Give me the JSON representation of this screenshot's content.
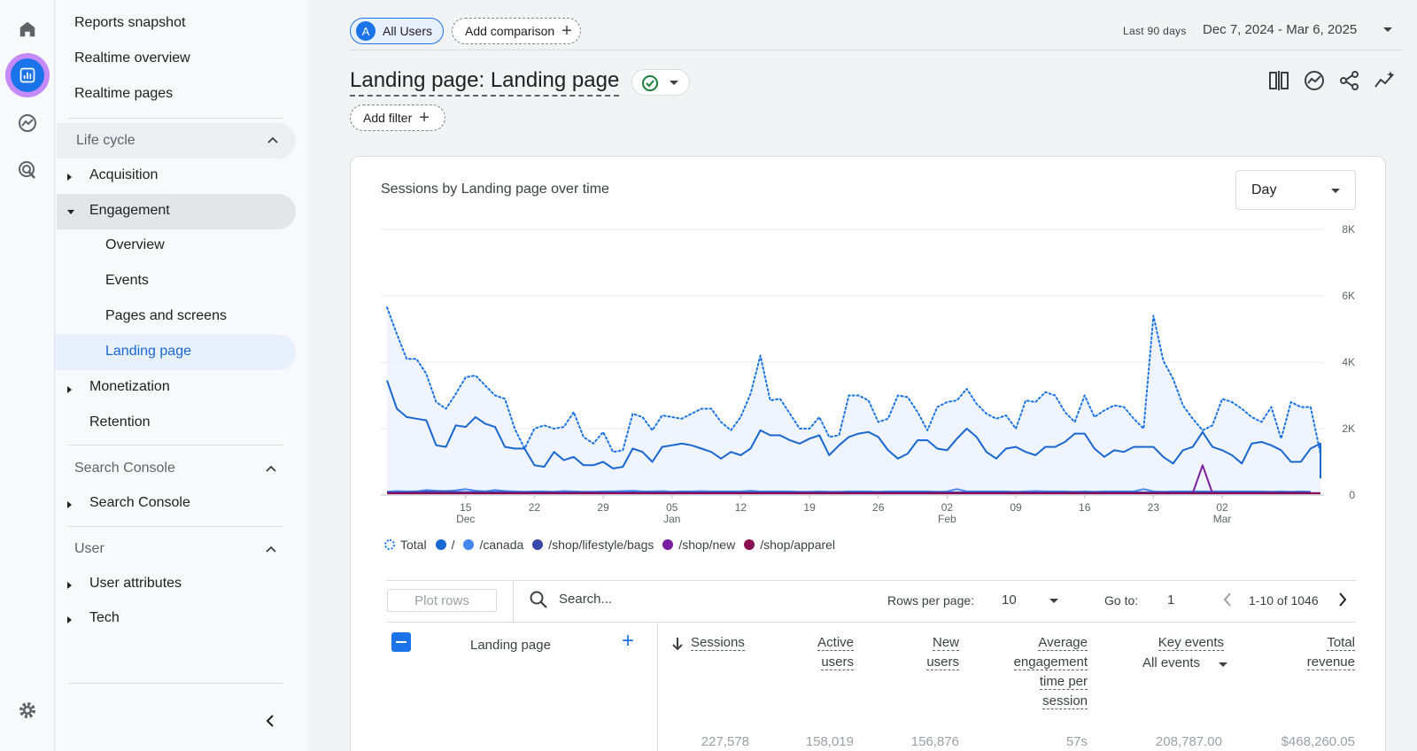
{
  "rail": {
    "icons": [
      "home-icon",
      "reports-icon",
      "explore-icon",
      "advertising-icon",
      "settings-icon"
    ]
  },
  "sidebar": {
    "top_items": [
      "Reports snapshot",
      "Realtime overview",
      "Realtime pages"
    ],
    "lifecycle": {
      "label": "Life cycle",
      "acquisition": "Acquisition",
      "engagement": "Engagement",
      "engagement_children": [
        "Overview",
        "Events",
        "Pages and screens",
        "Landing page"
      ],
      "monetization": "Monetization",
      "retention": "Retention"
    },
    "search_console": {
      "label": "Search Console",
      "child": "Search Console"
    },
    "user": {
      "label": "User",
      "attributes": "User attributes",
      "tech": "Tech"
    }
  },
  "header": {
    "user_chip": {
      "avatar": "A",
      "label": "All Users"
    },
    "compare_chip": "Add comparison",
    "date_badge": "Last 90 days",
    "date_range": "Dec 7, 2024 - Mar 6, 2025"
  },
  "page": {
    "title": "Landing page: Landing page",
    "add_filter": "Add filter"
  },
  "card": {
    "title": "Sessions by Landing page over time",
    "granularity": "Day"
  },
  "chart_data": {
    "type": "line",
    "title": "Sessions by Landing page over time",
    "x_ticks": [
      {
        "label": "15",
        "sub": "Dec"
      },
      {
        "label": "22",
        "sub": ""
      },
      {
        "label": "29",
        "sub": ""
      },
      {
        "label": "05",
        "sub": "Jan"
      },
      {
        "label": "12",
        "sub": ""
      },
      {
        "label": "19",
        "sub": ""
      },
      {
        "label": "26",
        "sub": ""
      },
      {
        "label": "02",
        "sub": "Feb"
      },
      {
        "label": "09",
        "sub": ""
      },
      {
        "label": "16",
        "sub": ""
      },
      {
        "label": "23",
        "sub": ""
      },
      {
        "label": "02",
        "sub": "Mar"
      }
    ],
    "y_ticks": [
      "0",
      "2K",
      "4K",
      "6K",
      "8K"
    ],
    "ylim": [
      0,
      8000
    ],
    "x_start": "Dec 7",
    "series": [
      {
        "name": "Total",
        "color": "#1a73e8",
        "style": "dotted",
        "values": [
          5650,
          4850,
          4100,
          4100,
          3650,
          2800,
          2600,
          3050,
          3550,
          3600,
          3300,
          3000,
          2900,
          2000,
          1400,
          2000,
          2100,
          2000,
          2050,
          2500,
          1750,
          1550,
          1900,
          1300,
          1350,
          2450,
          2350,
          1950,
          2400,
          2350,
          2300,
          2450,
          2600,
          2600,
          2200,
          1950,
          2350,
          3050,
          4200,
          2850,
          2900,
          2450,
          2000,
          2000,
          2350,
          1750,
          1800,
          3000,
          3000,
          2850,
          2200,
          2300,
          3000,
          2950,
          2500,
          1950,
          2650,
          2800,
          2850,
          3200,
          2750,
          2450,
          2300,
          2400,
          2000,
          2850,
          2800,
          3100,
          3000,
          2500,
          2200,
          3000,
          2350,
          2550,
          2700,
          2650,
          2300,
          2000,
          5400,
          4050,
          3500,
          2700,
          2300,
          1950,
          2100,
          2900,
          2800,
          2600,
          2350,
          2200,
          2650,
          1700,
          2800,
          2650,
          2650,
          1250
        ]
      },
      {
        "name": "/",
        "color": "#1967d2",
        "style": "solid",
        "values": [
          3450,
          2600,
          2350,
          2300,
          2250,
          1500,
          1450,
          2100,
          2050,
          2350,
          2150,
          2050,
          1450,
          1400,
          1400,
          900,
          850,
          1300,
          1050,
          1150,
          900,
          900,
          1000,
          800,
          850,
          1400,
          1300,
          1000,
          1450,
          1500,
          1550,
          1500,
          1400,
          1300,
          1100,
          1300,
          1200,
          1400,
          1950,
          1800,
          1800,
          1650,
          1550,
          1700,
          1800,
          1200,
          1500,
          1750,
          1850,
          1900,
          1750,
          1350,
          1100,
          1250,
          1650,
          1650,
          1400,
          1350,
          1700,
          2000,
          1750,
          1300,
          1100,
          1400,
          1450,
          1300,
          1200,
          1450,
          1450,
          1600,
          1850,
          1850,
          1400,
          1150,
          1350,
          1300,
          1450,
          1450,
          1450,
          1150,
          950,
          1350,
          1450,
          1900,
          1450,
          1350,
          1200,
          950,
          1550,
          1600,
          1500,
          1350,
          1000,
          1000,
          1400,
          1550,
          1400,
          1450,
          1550,
          500
        ]
      },
      {
        "name": "/canada",
        "color": "#4285f4",
        "style": "solid",
        "values": [
          100,
          120,
          110,
          110,
          150,
          130,
          120,
          140,
          180,
          130,
          110,
          150,
          120,
          110,
          100,
          110,
          110,
          100,
          120,
          110,
          100,
          100,
          110,
          110,
          120,
          130,
          110,
          110,
          120,
          100,
          110,
          110,
          120,
          110,
          110,
          110,
          110,
          130,
          110,
          110,
          110,
          110,
          100,
          100,
          110,
          100,
          100,
          110,
          110,
          110,
          100,
          110,
          110,
          110,
          110,
          110,
          100,
          110,
          180,
          110,
          110,
          110,
          110,
          110,
          100,
          110,
          120,
          110,
          110,
          110,
          100,
          110,
          100,
          110,
          110,
          110,
          110,
          180,
          110,
          100,
          110,
          110,
          110,
          110,
          110,
          110,
          110,
          110,
          110,
          110,
          100,
          110,
          100,
          110,
          100
        ]
      },
      {
        "name": "/shop/lifestyle/bags",
        "color": "#3949ab",
        "style": "solid",
        "values": [
          80,
          80,
          80,
          90,
          100,
          100,
          100,
          90,
          90,
          90,
          90,
          90,
          90,
          80,
          80,
          80,
          80,
          80,
          80,
          80,
          80,
          80,
          80,
          80,
          80,
          80,
          80,
          80,
          80,
          80,
          80,
          80,
          80,
          80,
          80,
          80,
          80,
          80,
          80,
          80,
          80,
          80,
          80,
          80,
          80,
          80,
          80,
          80,
          80,
          80,
          80,
          80,
          80,
          80,
          80,
          80,
          80,
          80,
          80,
          80,
          80,
          80,
          80,
          80,
          80,
          80,
          80,
          80,
          80,
          80,
          80,
          80,
          80,
          80,
          80,
          80,
          80,
          80,
          80,
          80,
          80,
          80,
          80,
          80,
          80,
          80,
          80,
          80,
          80,
          80,
          80,
          80,
          80,
          80,
          80
        ]
      },
      {
        "name": "/shop/new",
        "color": "#7b1fa2",
        "style": "solid",
        "values": [
          60,
          60,
          60,
          60,
          60,
          60,
          60,
          60,
          60,
          60,
          60,
          60,
          60,
          60,
          60,
          60,
          60,
          60,
          60,
          60,
          60,
          60,
          60,
          60,
          60,
          60,
          60,
          60,
          60,
          60,
          60,
          60,
          60,
          60,
          60,
          60,
          60,
          60,
          60,
          60,
          60,
          60,
          60,
          60,
          60,
          60,
          60,
          60,
          60,
          60,
          60,
          60,
          60,
          60,
          60,
          60,
          60,
          60,
          60,
          60,
          60,
          60,
          60,
          60,
          60,
          60,
          60,
          60,
          60,
          60,
          60,
          60,
          60,
          60,
          60,
          60,
          60,
          60,
          60,
          60,
          60,
          60,
          60,
          900,
          60,
          60,
          60,
          60,
          60,
          60,
          60,
          60,
          60,
          60,
          60,
          60,
          60,
          60,
          60
        ]
      },
      {
        "name": "/shop/apparel",
        "color": "#880e4f",
        "style": "solid",
        "values": [
          50,
          50,
          50,
          50,
          50,
          50,
          50,
          50,
          50,
          50,
          50,
          50,
          50,
          50,
          50,
          50,
          50,
          50,
          50,
          50,
          50,
          50,
          50,
          50,
          50,
          50,
          50,
          50,
          50,
          50,
          50,
          50,
          50,
          50,
          50,
          50,
          50,
          50,
          50,
          50,
          50,
          50,
          50,
          50,
          50,
          50,
          50,
          50,
          50,
          50,
          50,
          50,
          50,
          50,
          50,
          50,
          50,
          50,
          50,
          50,
          50,
          50,
          50,
          50,
          50,
          50,
          50,
          50,
          50,
          50,
          50,
          50,
          50,
          50,
          50,
          50,
          50,
          50,
          50,
          50,
          50,
          50,
          50,
          50,
          50,
          50,
          50,
          50,
          50,
          50,
          50,
          50,
          50,
          50,
          50,
          50,
          50,
          50,
          50
        ]
      }
    ]
  },
  "table": {
    "plot_rows": "Plot rows",
    "search_placeholder": "Search...",
    "rows_per_page_label": "Rows per page:",
    "rows_per_page": "10",
    "goto_label": "Go to:",
    "goto_value": "1",
    "pagination": "1-10 of 1046",
    "columns": {
      "landing_page": "Landing page",
      "sessions": "Sessions",
      "active_users": [
        "Active",
        "users"
      ],
      "new_users": [
        "New",
        "users"
      ],
      "avg_engagement": [
        "Average",
        "engagement",
        "time per",
        "session"
      ],
      "key_events": "Key events",
      "key_events_sub": "All events",
      "total_revenue": [
        "Total",
        "revenue"
      ]
    },
    "totals": [
      "227,578",
      "158,019",
      "156,876",
      "57s",
      "208,787.00",
      "$468,260.05"
    ]
  }
}
